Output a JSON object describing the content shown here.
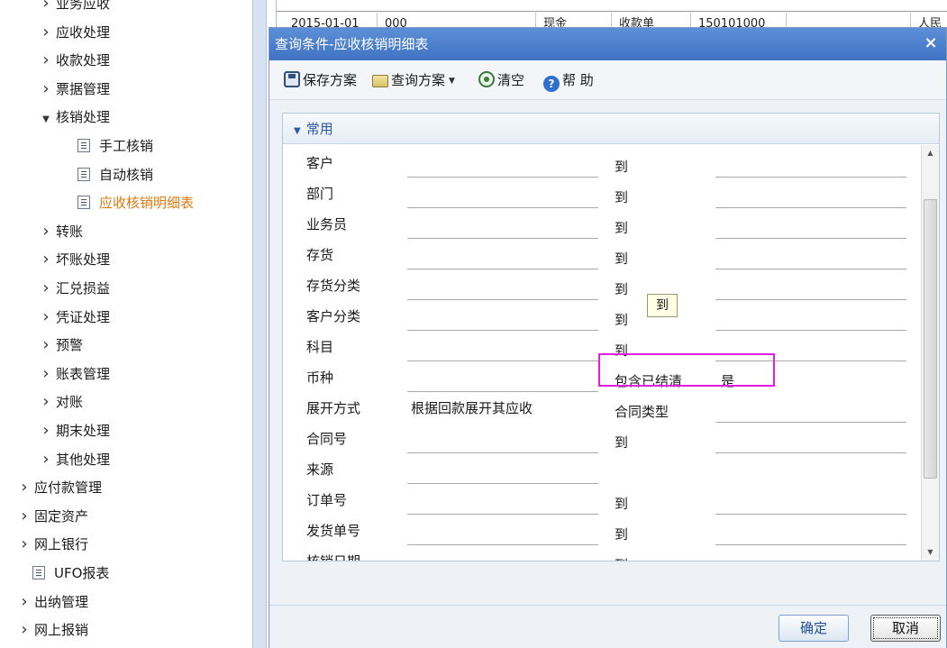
{
  "sidebar": {
    "items": [
      {
        "label": "业务应收",
        "level": 2,
        "type": "collapsed"
      },
      {
        "label": "应收处理",
        "level": 2,
        "type": "collapsed"
      },
      {
        "label": "收款处理",
        "level": 2,
        "type": "collapsed"
      },
      {
        "label": "票据管理",
        "level": 2,
        "type": "collapsed"
      },
      {
        "label": "核销处理",
        "level": 2,
        "type": "expanded"
      },
      {
        "label": "手工核销",
        "level": 3,
        "type": "leaf"
      },
      {
        "label": "自动核销",
        "level": 3,
        "type": "leaf"
      },
      {
        "label": "应收核销明细表",
        "level": 3,
        "type": "leaf",
        "active": true
      },
      {
        "label": "转账",
        "level": 2,
        "type": "collapsed"
      },
      {
        "label": "坏账处理",
        "level": 2,
        "type": "collapsed"
      },
      {
        "label": "汇兑损益",
        "level": 2,
        "type": "collapsed"
      },
      {
        "label": "凭证处理",
        "level": 2,
        "type": "collapsed"
      },
      {
        "label": "预警",
        "level": 2,
        "type": "collapsed"
      },
      {
        "label": "账表管理",
        "level": 2,
        "type": "collapsed"
      },
      {
        "label": "对账",
        "level": 2,
        "type": "collapsed"
      },
      {
        "label": "期末处理",
        "level": 2,
        "type": "collapsed"
      },
      {
        "label": "其他处理",
        "level": 2,
        "type": "collapsed"
      },
      {
        "label": "应付款管理",
        "level": 1,
        "type": "collapsed"
      },
      {
        "label": "固定资产",
        "level": 1,
        "type": "collapsed"
      },
      {
        "label": "网上银行",
        "level": 1,
        "type": "collapsed"
      },
      {
        "label": "UFO报表",
        "level": 1,
        "type": "leaf"
      },
      {
        "label": "出纳管理",
        "level": 1,
        "type": "collapsed"
      },
      {
        "label": "网上报销",
        "level": 1,
        "type": "collapsed"
      }
    ]
  },
  "background_grid": {
    "cells": [
      "2015-01-01",
      "000",
      "",
      "现金",
      "收款单",
      "150101000",
      "",
      "人民"
    ]
  },
  "dialog": {
    "title": "查询条件-应收核销明细表",
    "close_label": "×",
    "toolbar": {
      "save_scheme": "保存方案",
      "query_scheme": "查询方案",
      "clear": "清空",
      "help": "帮 助",
      "help_glyph": "?",
      "dropdown_caret": "▼"
    },
    "panel": {
      "header": "常用",
      "header_caret": "▼",
      "scroll_up": "▲",
      "scroll_down": "▼",
      "rows": [
        {
          "label": "客户",
          "value1": "",
          "mid": "到",
          "value2": ""
        },
        {
          "label": "部门",
          "value1": "",
          "mid": "到",
          "value2": ""
        },
        {
          "label": "业务员",
          "value1": "",
          "mid": "到",
          "value2": ""
        },
        {
          "label": "存货",
          "value1": "",
          "mid": "到",
          "value2": ""
        },
        {
          "label": "存货分类",
          "value1": "",
          "mid": "到",
          "value2": ""
        },
        {
          "label": "客户分类",
          "value1": "",
          "mid": "到",
          "value2": ""
        },
        {
          "label": "科目",
          "value1": "",
          "mid": "到",
          "value2": ""
        },
        {
          "label": "币种",
          "value1": "",
          "mid": "包含已结清",
          "value2": "是"
        },
        {
          "label": "展开方式",
          "value1": "根据回款展开其应收",
          "mid": "合同类型",
          "value2": ""
        },
        {
          "label": "合同号",
          "value1": "",
          "mid": "到",
          "value2": ""
        },
        {
          "label": "来源",
          "value1": "",
          "mid": "",
          "value2": ""
        },
        {
          "label": "订单号",
          "value1": "",
          "mid": "到",
          "value2": ""
        },
        {
          "label": "发货单号",
          "value1": "",
          "mid": "到",
          "value2": ""
        },
        {
          "label": "核销日期",
          "value1": "",
          "mid": "到",
          "value2": ""
        }
      ],
      "tooltip": "到"
    },
    "footer": {
      "ok": "确定",
      "cancel": "取消"
    }
  }
}
